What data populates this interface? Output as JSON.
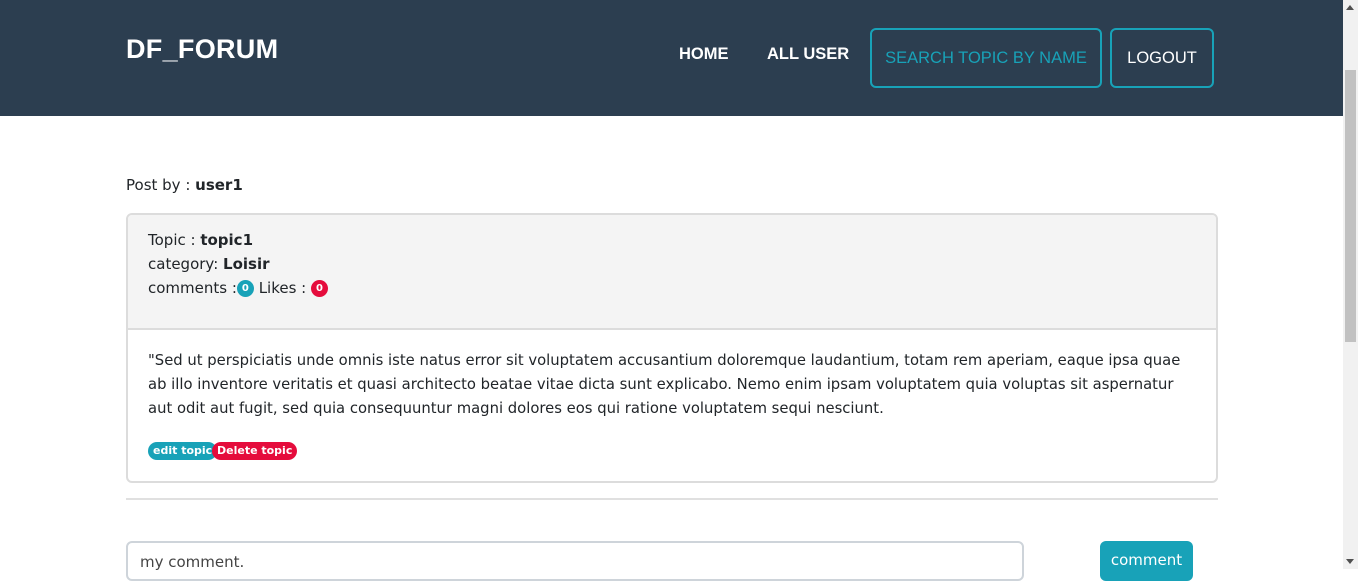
{
  "navbar": {
    "brand": "DF_FORUM",
    "home": "HOME",
    "all_user": "ALL USER",
    "search": "SEARCH TOPIC BY NAME",
    "logout": "LOGOUT"
  },
  "post": {
    "by_label": "Post by : ",
    "author": "user1",
    "topic_label": "Topic : ",
    "topic": "topic1",
    "category_label": "category: ",
    "category": "Loisir",
    "comments_label": "comments :",
    "comments_count": "0",
    "likes_label": "Likes : ",
    "likes_count": "0",
    "body": "\"Sed ut perspiciatis unde omnis iste natus error sit voluptatem accusantium doloremque laudantium, totam rem aperiam, eaque ipsa quae ab illo inventore veritatis et quasi architecto beatae vitae dicta sunt explicabo. Nemo enim ipsam voluptatem quia voluptas sit aspernatur aut odit aut fugit, sed quia consequuntur magni dolores eos qui ratione voluptatem sequi nesciunt.",
    "edit_label": "edit topic",
    "delete_label": "Delete topic"
  },
  "comment_form": {
    "placeholder": "my comment.",
    "button": "comment"
  },
  "colors": {
    "navbar": "#2c3e50",
    "accent": "#18a2b8",
    "danger": "#e50c3c"
  }
}
